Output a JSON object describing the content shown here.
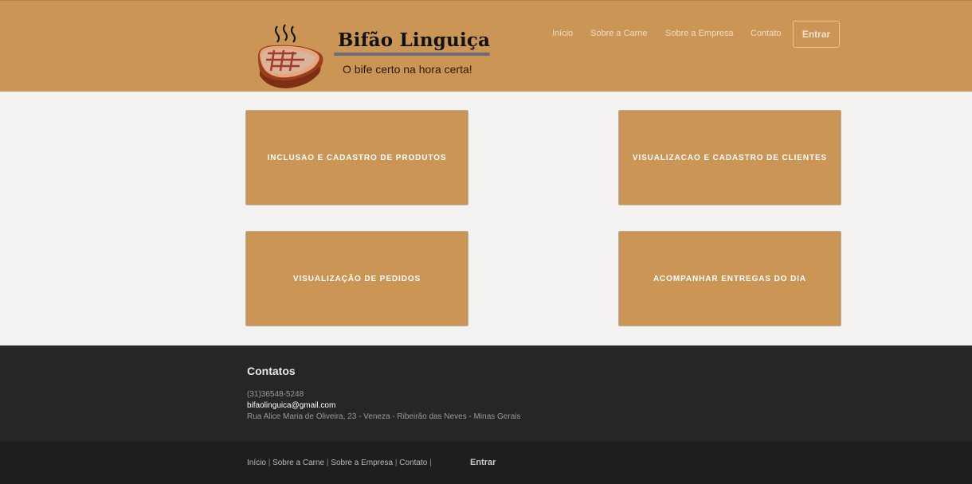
{
  "header": {
    "brand_title": "Bifão Linguiça",
    "tagline": "O bife certo na hora certa!",
    "nav": [
      "Início",
      "Sobre a Carne",
      "Sobre a Empresa",
      "Contato"
    ],
    "login_button": "Entrar"
  },
  "tiles": [
    "INCLUSAO E CADASTRO DE PRODUTOS",
    "VISUALIZACAO E CADASTRO DE CLIENTES",
    "VISUALIZAÇÃO DE PEDIDOS",
    "ACOMPANHAR ENTREGAS DO DIA"
  ],
  "footer": {
    "title": "Contatos",
    "phone": "(31)36548-5248",
    "email": "bifaolinguica@gmail.com",
    "address": "Rua Alice Maria de Oliveira, 23 - Veneza - Ribeirão das Neves - Minas Gerais"
  },
  "bottom_nav": {
    "items": [
      "Início",
      "Sobre a Carne",
      "Sobre a Empresa",
      "Contato"
    ],
    "separator": "|",
    "login": "Entrar"
  },
  "colors": {
    "header_bg": "#cb9556",
    "tile_bg": "#cb9556",
    "page_bg": "#f5f3f1",
    "footer_bg": "#262626",
    "bottom_bg": "#1e1e1e"
  }
}
